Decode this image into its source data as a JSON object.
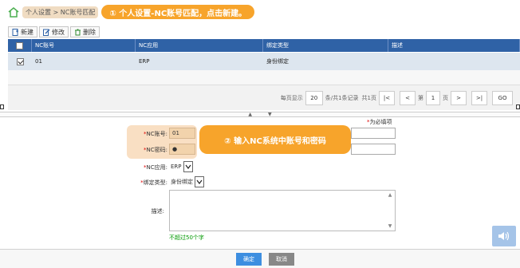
{
  "breadcrumb": {
    "path": "个人设置 > NC账号匹配",
    "callout": "① 个人设置-NC账号匹配，点击新建。"
  },
  "toolbar": {
    "new_label": "新建",
    "edit_label": "修改",
    "delete_label": "删除"
  },
  "grid": {
    "columns": [
      "NC账号",
      "NC应用",
      "绑定类型",
      "描述"
    ],
    "rows": [
      {
        "checked": true,
        "nc_account": "01",
        "nc_app": "ERP",
        "bind_type": "身份绑定",
        "description": ""
      }
    ]
  },
  "pager": {
    "per_page_label": "每页显示",
    "per_page": "20",
    "summary": "条/共1条记录",
    "pages_total": "共1页",
    "page_prefix": "第",
    "page": "1",
    "page_suffix": "页",
    "go_label": "GO",
    "first_glyph": "|<",
    "prev_glyph": "<",
    "next_glyph": ">",
    "last_glyph": ">|"
  },
  "form": {
    "required_note": "为必填项",
    "nc_account_label": "NC账号:",
    "nc_account_value": "01",
    "nc_password_label": "NC密码:",
    "nc_password_value": "●",
    "callout": "② 输入NC系统中账号和密码",
    "nc_app_label": "NC应用:",
    "nc_app_value": "ERP",
    "bind_type_label": "绑定类型:",
    "bind_type_value": "身份绑定",
    "desc_label": "描述:",
    "desc_value": "",
    "hint": "不超过50个字"
  },
  "buttons": {
    "ok": "确定",
    "cancel": "取消"
  },
  "colors": {
    "grid_header": "#2f62a6",
    "callout": "#f7a42b",
    "ok_button": "#3d8ee0"
  }
}
